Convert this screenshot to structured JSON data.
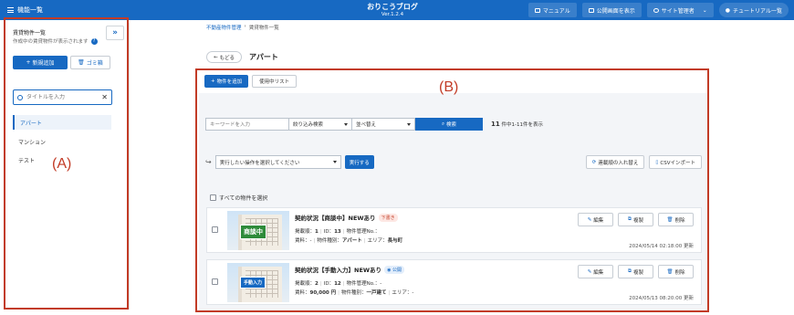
{
  "topbar": {
    "menu_label": "機能一覧",
    "brand": "おりこうブログ",
    "version": "Ver.1.2.4",
    "buttons": [
      "マニュアル",
      "公開画面を表示",
      "サイト管理者",
      "チュートリアル一覧"
    ]
  },
  "sidebar": {
    "title": "賃貸物件一覧",
    "subtitle": "作成中の賃貸物件が表示されます",
    "collapse_icon": "»",
    "new_button": "新規追加",
    "trash_button": "ゴミ箱",
    "search_placeholder": "タイトルを入力",
    "items": [
      {
        "label": "アパート",
        "active": true
      },
      {
        "label": "マンション",
        "active": false
      },
      {
        "label": "テスト",
        "active": false
      }
    ]
  },
  "breadcrumb": {
    "root": "不動産物件管理",
    "sep": "›",
    "current": "賃貸物件一覧"
  },
  "back_button": "もどる",
  "page_title": "アパート",
  "main": {
    "tab_add": "物件を追加",
    "tab_used": "使用中リスト",
    "keyword_placeholder": "キーワードを入力",
    "filter_select": "絞り込み検索",
    "sort_select": "並べ替え",
    "search_button": "検索",
    "count_num": "11",
    "count_text": "件中1-11件を表示",
    "action_select": "実行したい操作を選択してください",
    "run_button": "実行する",
    "reorder_button": "連載順の入れ替え",
    "csv_button": "CSVインポート",
    "select_all": "すべての物件を選択"
  },
  "cards": [
    {
      "title": "契約状況【商談中】NEWあり",
      "badge": "下書き",
      "stamp": "商談中",
      "line1": {
        "order_label": "掲載順：",
        "order": "1",
        "id_label": "ID：",
        "id": "13",
        "mgmt_label": "物件管理No.：",
        "mgmt": ""
      },
      "line2": {
        "rent_label": "賃料：",
        "rent": "-",
        "type_label": "物件種別：",
        "type": "アパート",
        "area_label": "エリア：",
        "area": "長与町"
      },
      "date": "2024/05/14 02:18:00 更新",
      "edit": "編集",
      "copy": "複製",
      "delete": "削除"
    },
    {
      "title": "契約状況【手動入力】NEWあり",
      "badge": "公開",
      "stamp": "手動入力",
      "line1": {
        "order_label": "掲載順：",
        "order": "2",
        "id_label": "ID：",
        "id": "12",
        "mgmt_label": "物件管理No.：",
        "mgmt": "-"
      },
      "line2": {
        "rent_label": "賃料：",
        "rent": "90,000 円",
        "type_label": "物件種別：",
        "type": "一戸建て",
        "area_label": "エリア：",
        "area": "-"
      },
      "date": "2024/05/13 08:20:00 更新",
      "edit": "編集",
      "copy": "複製",
      "delete": "削除"
    }
  ],
  "annotations": {
    "a": "(A)",
    "b": "(B)"
  },
  "colors": {
    "primary": "#1769c2",
    "annotation": "#c23b26"
  }
}
